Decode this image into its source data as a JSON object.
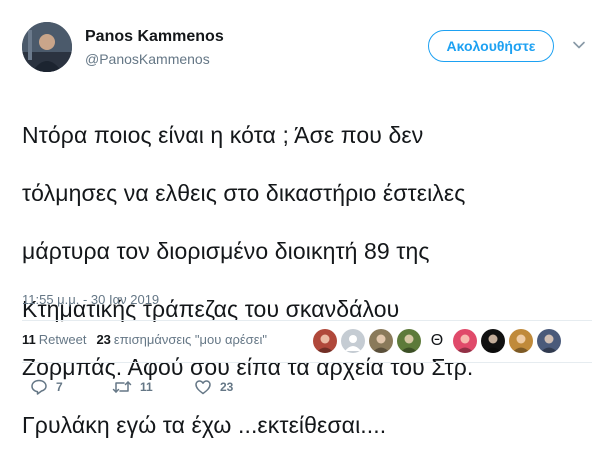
{
  "author": {
    "name": "Panos Kammenos",
    "handle": "@PanosKammenos"
  },
  "follow_button": {
    "label": "Ακολουθήστε"
  },
  "tweet": {
    "lines": [
      "Ντόρα ποιος είναι η κότα ; Άσε που δεν",
      "τόλμησες να ελθεις στο δικαστήριο έστειλες",
      "μάρτυρα τον διορισμένο διοικητή 89 της",
      "Κτηματικής τράπεζας του σκανδάλου",
      "Ζορμπάς. Αφού σου είπα  τα αρχεία του Στρ.",
      "Γρυλάκη εγώ τα έχω ...εκτείθεσαι...."
    ],
    "timestamp": "11:55 μ.μ. - 30 Ιαν 2019"
  },
  "stats": {
    "retweets_count": "11",
    "retweets_label": "Retweet",
    "likes_count": "23",
    "likes_label": "επισημάνσεις \"μου αρέσει\""
  },
  "likers": [
    {
      "icon": "photo-avatar",
      "color": "#b0483a"
    },
    {
      "icon": "default-avatar",
      "color": "#c5ccd3"
    },
    {
      "icon": "photo-avatar",
      "color": "#8a7a5a"
    },
    {
      "icon": "photo-avatar",
      "color": "#5d7a3a"
    },
    {
      "icon": "theta-glyph",
      "glyph": "Θ",
      "color": "#ffffff"
    },
    {
      "icon": "photo-avatar",
      "color": "#e04a6a"
    },
    {
      "icon": "photo-avatar",
      "color": "#111111"
    },
    {
      "icon": "photo-avatar",
      "color": "#c08a3a"
    },
    {
      "icon": "photo-avatar",
      "color": "#4a5a7a"
    }
  ],
  "actions": {
    "reply_count": "7",
    "retweet_count": "11",
    "like_count": "23"
  },
  "colors": {
    "accent": "#1da1f2",
    "text": "#14171a",
    "muted": "#657786",
    "divider": "#e6ecf0"
  }
}
